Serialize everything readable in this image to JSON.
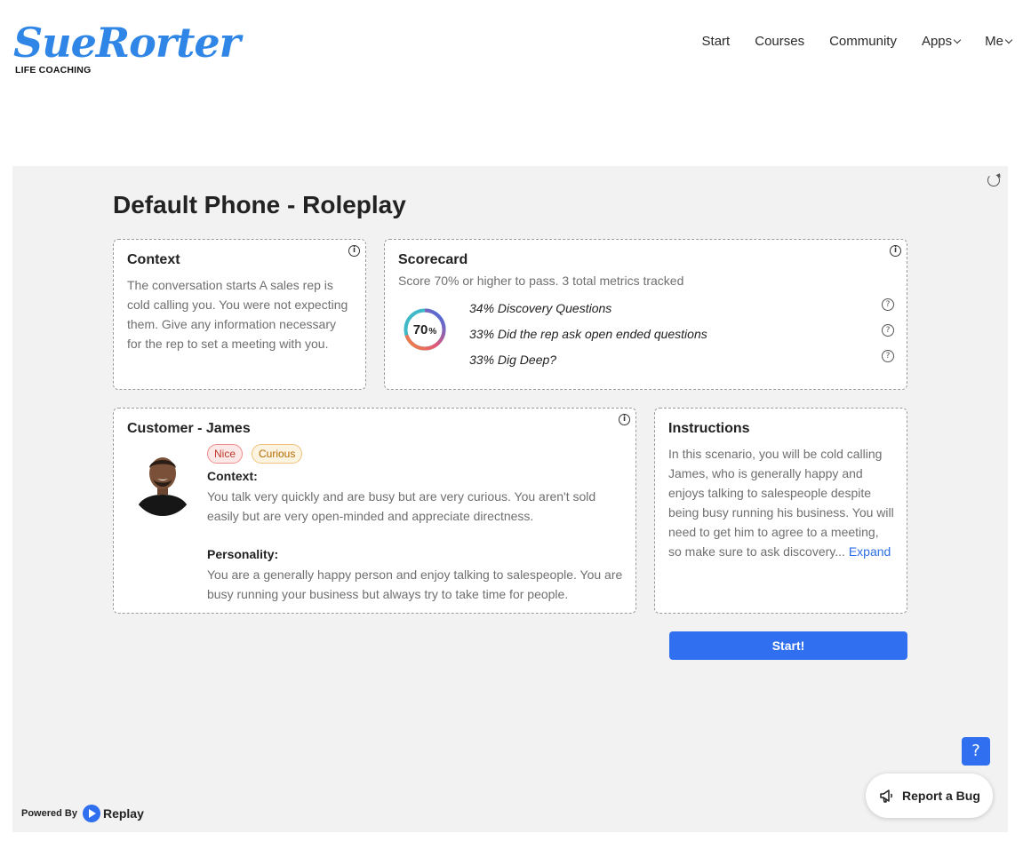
{
  "brand": {
    "name": "SueRorter",
    "tagline": "LIFE COACHING",
    "color": "#2f86e6"
  },
  "nav": {
    "items": [
      {
        "label": "Start",
        "dropdown": false
      },
      {
        "label": "Courses",
        "dropdown": false
      },
      {
        "label": "Community",
        "dropdown": false
      },
      {
        "label": "Apps",
        "dropdown": true
      },
      {
        "label": "Me",
        "dropdown": true
      }
    ]
  },
  "page": {
    "title": "Default Phone - Roleplay"
  },
  "context": {
    "title": "Context",
    "text": "The conversation starts A sales rep is cold calling you. You were not expecting them. Give any information necessary for the rep to set a meeting with you."
  },
  "scorecard": {
    "title": "Scorecard",
    "subtitle": "Score 70% or higher to pass. 3 total metrics tracked",
    "pass_score": 70,
    "pass_score_num": "70",
    "pass_score_unit": "%",
    "metrics": [
      {
        "label": "34% Discovery Questions",
        "weight": 34
      },
      {
        "label": "33% Did the rep ask open ended questions",
        "weight": 33
      },
      {
        "label": "33% Dig Deep?",
        "weight": 33
      }
    ]
  },
  "customer": {
    "title": "Customer - James",
    "tags": [
      "Nice",
      "Curious"
    ],
    "context_label": "Context:",
    "context_text": "You talk very quickly and are busy but are very curious. You aren't sold easily but are very open-minded and appreciate directness.",
    "personality_label": "Personality:",
    "personality_text": "You are a generally happy person and enjoy talking to salespeople. You are busy running your business but always try to take time for people."
  },
  "instructions": {
    "title": "Instructions",
    "text": "In this scenario, you will be cold calling James, who is generally happy and enjoys talking to salespeople despite being busy running his business. You will need to get him to agree to a meeting, so make sure to ask discovery...",
    "expand_label": "Expand"
  },
  "actions": {
    "start_label": "Start!",
    "help_label": "?",
    "report_bug_label": "Report a Bug"
  },
  "footer": {
    "powered_by": "Powered By",
    "replay": "Replay"
  },
  "colors": {
    "accent": "#2f6ff0",
    "panel_bg": "#f2f2f2"
  }
}
